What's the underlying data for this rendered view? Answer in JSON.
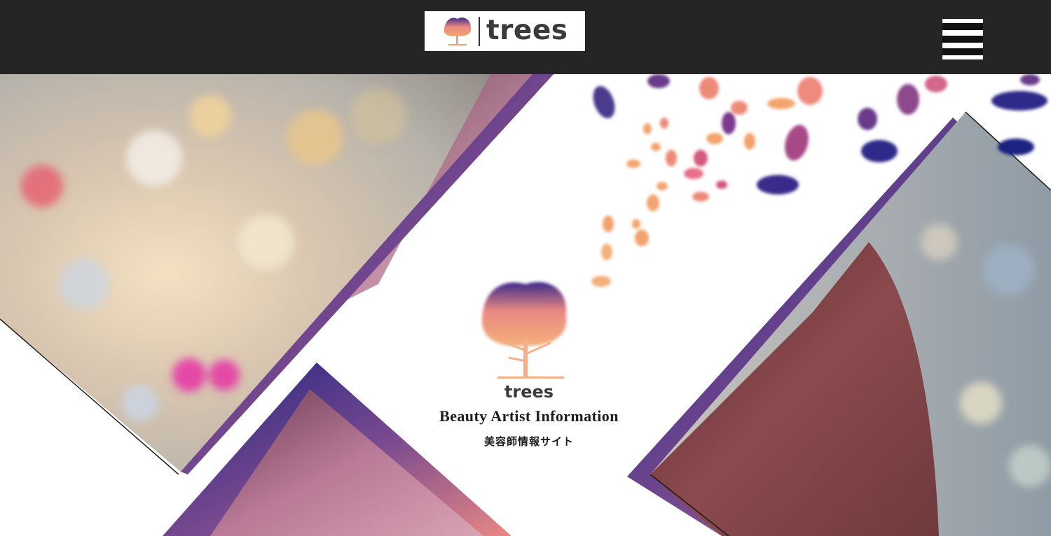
{
  "header": {
    "logo_text": "trees",
    "menu_icon": "hamburger-icon"
  },
  "hero": {
    "brand": "trees",
    "tagline": "Beauty Artist Information",
    "subtitle_jp": "美容師情報サイト",
    "prev_icon": "chevron-left-icon",
    "next_icon": "chevron-right-icon"
  },
  "colors": {
    "header_bg": "#252525",
    "accent_navy": "#1d2480",
    "accent_purple": "#6a3a8a",
    "accent_pink": "#e98883",
    "accent_orange": "#f2a36d"
  }
}
